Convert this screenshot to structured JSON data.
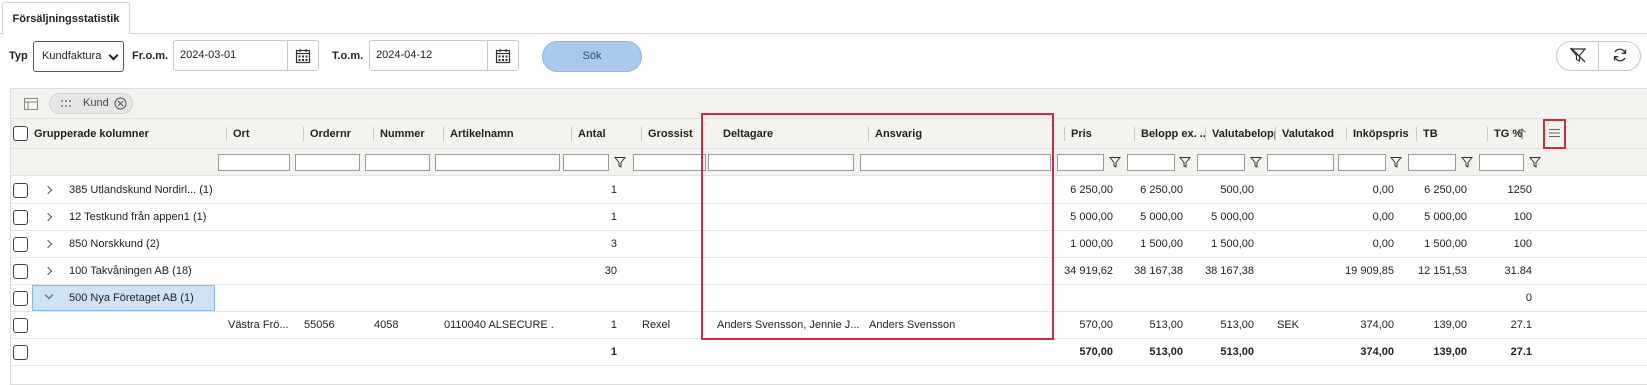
{
  "tab": {
    "label": "Försäljningsstatistik"
  },
  "toolbar": {
    "typ_label": "Typ",
    "typ_value": "Kundfaktura",
    "from_label": "Fr.o.m.",
    "from_value": "2024-03-01",
    "to_label": "T.o.m.",
    "to_value": "2024-04-12",
    "search_label": "Sök"
  },
  "grouping": {
    "chip_label": "Kund"
  },
  "columns": {
    "grouped": "Grupperade kolumner",
    "ort": "Ort",
    "ordernr": "Ordernr",
    "nummer": "Nummer",
    "artikelnamn": "Artikelnamn",
    "antal": "Antal",
    "grossist": "Grossist",
    "deltagare": "Deltagare",
    "ansvarig": "Ansvarig",
    "pris": "Pris",
    "belopp": "Belopp ex. ...",
    "valutabelopp": "Valutabelopp",
    "valutakod": "Valutakod",
    "inkopspris": "Inköpspris",
    "tb": "TB",
    "tg": "TG %"
  },
  "rows": [
    {
      "group": "385 Utlandskund Nordirl...  (1)",
      "antal": "1",
      "pris": "6 250,00",
      "belopp": "6 250,00",
      "valuta": "500,00",
      "inkop": "0,00",
      "tb": "6 250,00",
      "tg": "1250"
    },
    {
      "group": "12 Testkund från appen1 (1)",
      "antal": "1",
      "pris": "5 000,00",
      "belopp": "5 000,00",
      "valuta": "5 000,00",
      "inkop": "0,00",
      "tb": "5 000,00",
      "tg": "100"
    },
    {
      "group": "850 Norskkund (2)",
      "antal": "3",
      "pris": "1 000,00",
      "belopp": "1 500,00",
      "valuta": "1 500,00",
      "inkop": "0,00",
      "tb": "1 500,00",
      "tg": "100"
    },
    {
      "group": "100 Takvåningen AB (18)",
      "antal": "30",
      "pris": "34 919,62",
      "belopp": "38 167,38",
      "valuta": "38 167,38",
      "inkop": "19 909,85",
      "tb": "12 151,53",
      "tg": "31.84"
    },
    {
      "group": "500 Nya Företaget AB (1)",
      "tg": "0"
    }
  ],
  "detail": {
    "ort": "Västra Frö...",
    "ordernr": "55056",
    "nummer": "4058",
    "artikelnamn": "0110040 ALSECURE ...",
    "antal": "1",
    "grossist": "Rexel",
    "deltagare": "Anders Svensson, Jennie J...",
    "ansvarig": "Anders Svensson",
    "pris": "570,00",
    "belopp": "513,00",
    "valuta": "513,00",
    "valutakod": "SEK",
    "inkop": "374,00",
    "tb": "139,00",
    "tg": "27.1"
  },
  "totals": {
    "antal": "1",
    "pris": "570,00",
    "belopp": "513,00",
    "valuta": "513,00",
    "inkop": "374,00",
    "tb": "139,00",
    "tg": "27.1"
  },
  "colors": {
    "highlight": "#d62a3a",
    "accent": "#2b5ea6",
    "search_button": "#a9c9ef",
    "selected_row": "#cfe3f7"
  }
}
